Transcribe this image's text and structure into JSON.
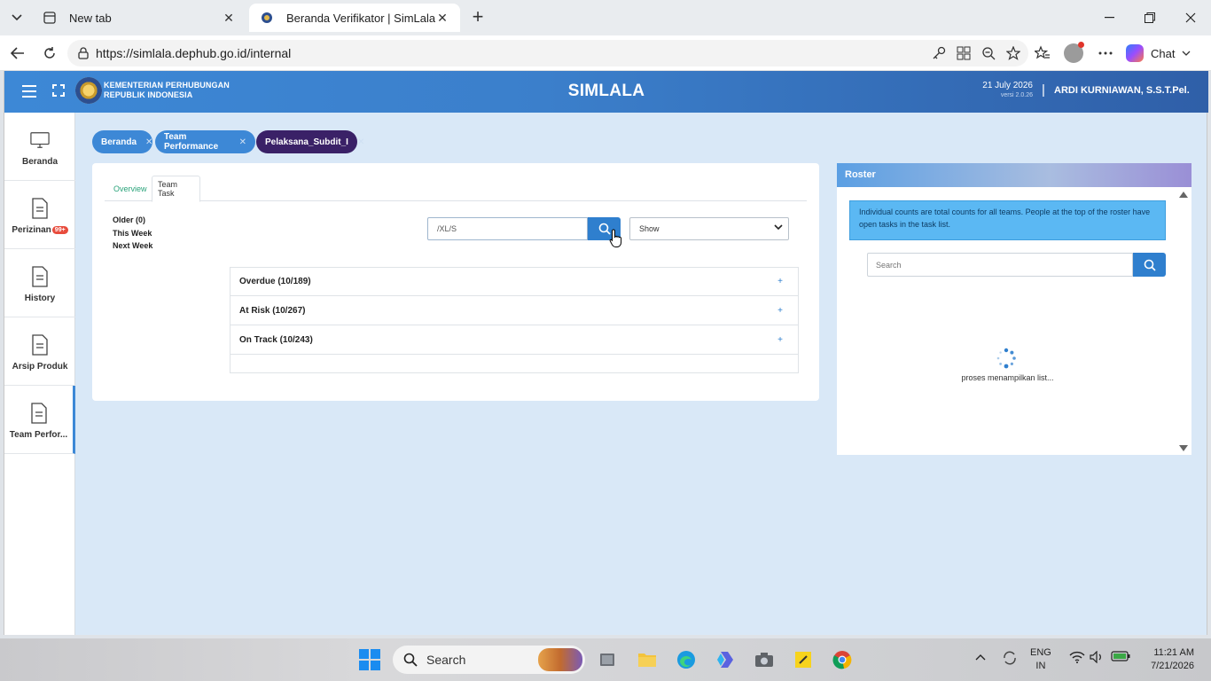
{
  "browser": {
    "tabs": [
      {
        "title": "New tab",
        "icon": "newtab-icon"
      },
      {
        "title": "Beranda Verifikator | SimLala",
        "icon": "site-favicon",
        "active": true
      }
    ],
    "url": "https://simlala.dephub.go.id/internal",
    "chat_label": "Chat"
  },
  "header": {
    "ministry_line1": "KEMENTERIAN PERHUBUNGAN",
    "ministry_line2": "REPUBLIK INDONESIA",
    "app_title": "SIMLALA",
    "date": "21 July 2026",
    "version": "versi 2.0.26",
    "separator": "|",
    "user": "ARDI KURNIAWAN, S.S.T.Pel."
  },
  "sidebar": {
    "items": [
      {
        "label": "Beranda",
        "icon": "monitor-icon"
      },
      {
        "label": "Perizinan",
        "icon": "document-icon",
        "badge": "99+"
      },
      {
        "label": "History",
        "icon": "document-icon"
      },
      {
        "label": "Arsip Produk",
        "icon": "document-icon"
      },
      {
        "label": "Team Perfor...",
        "icon": "document-icon",
        "active": true
      }
    ]
  },
  "breadcrumbs": [
    {
      "label": "Beranda"
    },
    {
      "label": "Team Performance"
    },
    {
      "label": "Pelaksana_Subdit_I"
    }
  ],
  "main": {
    "tabs": [
      {
        "label": "Overview"
      },
      {
        "label": "Team Task",
        "active": true
      }
    ],
    "periods": [
      "Older (0)",
      "This Week",
      "Next Week"
    ],
    "search_value": "/XL/S",
    "show_select": "Show",
    "accordion": [
      {
        "label": "Overdue (10/189)"
      },
      {
        "label": "At Risk (10/267)"
      },
      {
        "label": "On Track (10/243)"
      }
    ],
    "expand_symbol": "+"
  },
  "roster": {
    "title": "Roster",
    "info": "Individual counts are total counts for all teams. People at the top of the roster have open tasks in the task list.",
    "search_placeholder": "Search",
    "loading_text": "proses menampilkan list..."
  },
  "taskbar": {
    "search_label": "Search",
    "lang_line1": "ENG",
    "lang_line2": "IN",
    "time": "11:21 AM",
    "date": "7/21/2026"
  },
  "colors": {
    "header_blue": "#3d88d6",
    "active_crumb": "#3a2167",
    "accent_green": "#2aa37a",
    "info_box": "#5bb8f3",
    "badge_red": "#e84c3d"
  }
}
